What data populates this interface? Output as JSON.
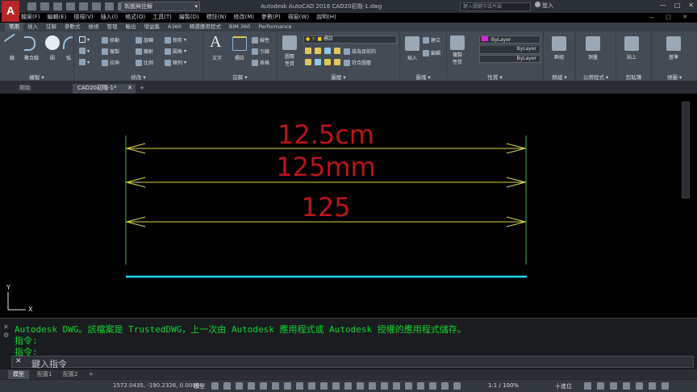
{
  "window": {
    "app_title": "Autodesk AutoCAD 2016   CAD20初階-1.dwg",
    "workspace": "製圖與註解",
    "search_placeholder": "鍵入關鍵字或片語",
    "signin": "登入",
    "controls": [
      "—",
      "□",
      "✕"
    ]
  },
  "menubar": {
    "items": [
      "檔案(F)",
      "編輯(E)",
      "檢視(V)",
      "插入(I)",
      "格式(O)",
      "工具(T)",
      "繪製(D)",
      "標註(N)",
      "修改(M)",
      "參數(P)",
      "視窗(W)",
      "說明(H)"
    ]
  },
  "ribbon_tabs": {
    "items": [
      "常用",
      "插入",
      "註解",
      "參數式",
      "檢視",
      "管理",
      "輸出",
      "增益集",
      "A360",
      "精選應用程式",
      "BIM 360",
      "Performance"
    ],
    "active": "常用"
  },
  "ribbon": {
    "draw": {
      "title": "繪製 ▾",
      "line": "線",
      "polyline": "聚合線",
      "circle": "圓",
      "arc": "弧"
    },
    "modify": {
      "title": "修改 ▾",
      "move": "移動",
      "rotate": "旋轉",
      "trim": "修剪",
      "copy": "複製",
      "mirror": "鏡射",
      "fillet": "圓角",
      "stretch": "拉伸",
      "scale": "比例",
      "array": "陣列"
    },
    "annotation": {
      "title": "註解 ▾",
      "text": "文字",
      "dimension": "標註",
      "linear": "線性",
      "leader": "引線",
      "table": "表格"
    },
    "layers": {
      "title": "圖層 ▾",
      "properties": "圖層\n性質",
      "current_layer": "標註",
      "make_current": "設為目前的",
      "match_layer": "符合圖層"
    },
    "block": {
      "title": "圖塊 ▾",
      "insert": "插入",
      "create": "建立",
      "edit": "編輯"
    },
    "properties": {
      "title": "性質 ▾",
      "match": "複製\n性質",
      "color": "ByLayer",
      "linetype": "ByLayer",
      "lineweight": "ByLayer"
    },
    "groups": {
      "title": "群組 ▾",
      "group": "群組"
    },
    "utilities": {
      "title": "公用程式 ▾",
      "measure": "測量"
    },
    "clipboard": {
      "title": "剪貼簿",
      "paste": "貼上"
    },
    "view": {
      "title": "視圖 ▾",
      "base": "基準"
    }
  },
  "doc_tabs": {
    "start": "開始",
    "active": "CAD20初階-1*",
    "add": "+"
  },
  "drawing": {
    "dimensions": [
      {
        "label": "12.5cm"
      },
      {
        "label": "125mm"
      },
      {
        "label": "125"
      }
    ],
    "colors": {
      "dimension_line": "#d8d84a",
      "dimension_text": "#b8161a",
      "extension_line": "#3fb83f",
      "base_line": "#20d8e8",
      "ucs": "#e6e6e6"
    },
    "ucs": {
      "x": "X",
      "y": "Y"
    }
  },
  "command_line": {
    "history": [
      "Autodesk DWG。該檔案是 TrustedDWG，上一次由 Autodesk 應用程式或 Autodesk 授權的應用程式儲存。",
      "指令:",
      "指令:"
    ],
    "prompt": "鍵入指令",
    "close": "✕"
  },
  "layout_tabs": {
    "items": [
      "模型",
      "配置1",
      "配置2"
    ],
    "active": "模型",
    "add": "+"
  },
  "statusbar": {
    "coords": "1572.0435, -190.2326, 0.0000",
    "model": "模型",
    "annotation_scale": "1:1 / 100%",
    "units": "十進位"
  }
}
